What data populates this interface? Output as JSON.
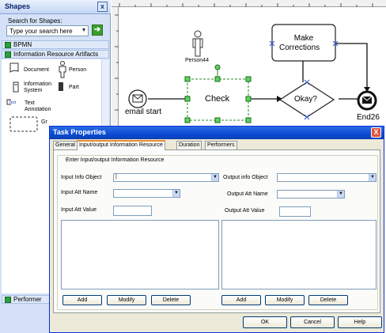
{
  "shapes_panel": {
    "title": "Shapes",
    "close_glyph": "x",
    "search_label": "Search for Shapes:",
    "search_value": "Type your search here",
    "search_go_icon": "arrow-right-icon",
    "stencils": {
      "bpmn": "BPMN",
      "info": "Information Resource Artifacts",
      "performer": "Performer"
    },
    "items": {
      "document": "Document",
      "person": "Person",
      "info_system_1": "Information",
      "info_system_2": "System",
      "part": "Part",
      "text_annotation_1": "Text",
      "text_annotation_2": "Annotation",
      "group": "Gr"
    }
  },
  "diagram": {
    "person_label": "Person44",
    "check_label": "Check",
    "email_start_label": "email start",
    "make_corrections_1": "Make",
    "make_corrections_2": "Corrections",
    "okay_label": "Okay?",
    "end_label": "End26"
  },
  "dialog": {
    "title": "Task Properties",
    "close_glyph": "X",
    "tabs": {
      "general": "General",
      "io": "Input/output Information Resource",
      "duration": "Duration",
      "performers": "Performers"
    },
    "group_title": "Enter Input/output Information Resource",
    "input": {
      "info_object_label": "Input Info Object",
      "att_name_label": "Input Att Name",
      "att_value_label": "Input Att Value",
      "info_object_value": "|"
    },
    "output": {
      "info_object_label": "Output info Object",
      "att_name_label": "Output Att Name",
      "att_value_label": "Output Att Value"
    },
    "buttons": {
      "add": "Add",
      "modify": "Modify",
      "delete": "Delete",
      "ok": "OK",
      "cancel": "Cancel",
      "help": "Help"
    }
  },
  "colors": {
    "accent_green": "#29a13a",
    "title_blue": "#0a4bd4",
    "dialog_bg": "#ece9d8"
  }
}
